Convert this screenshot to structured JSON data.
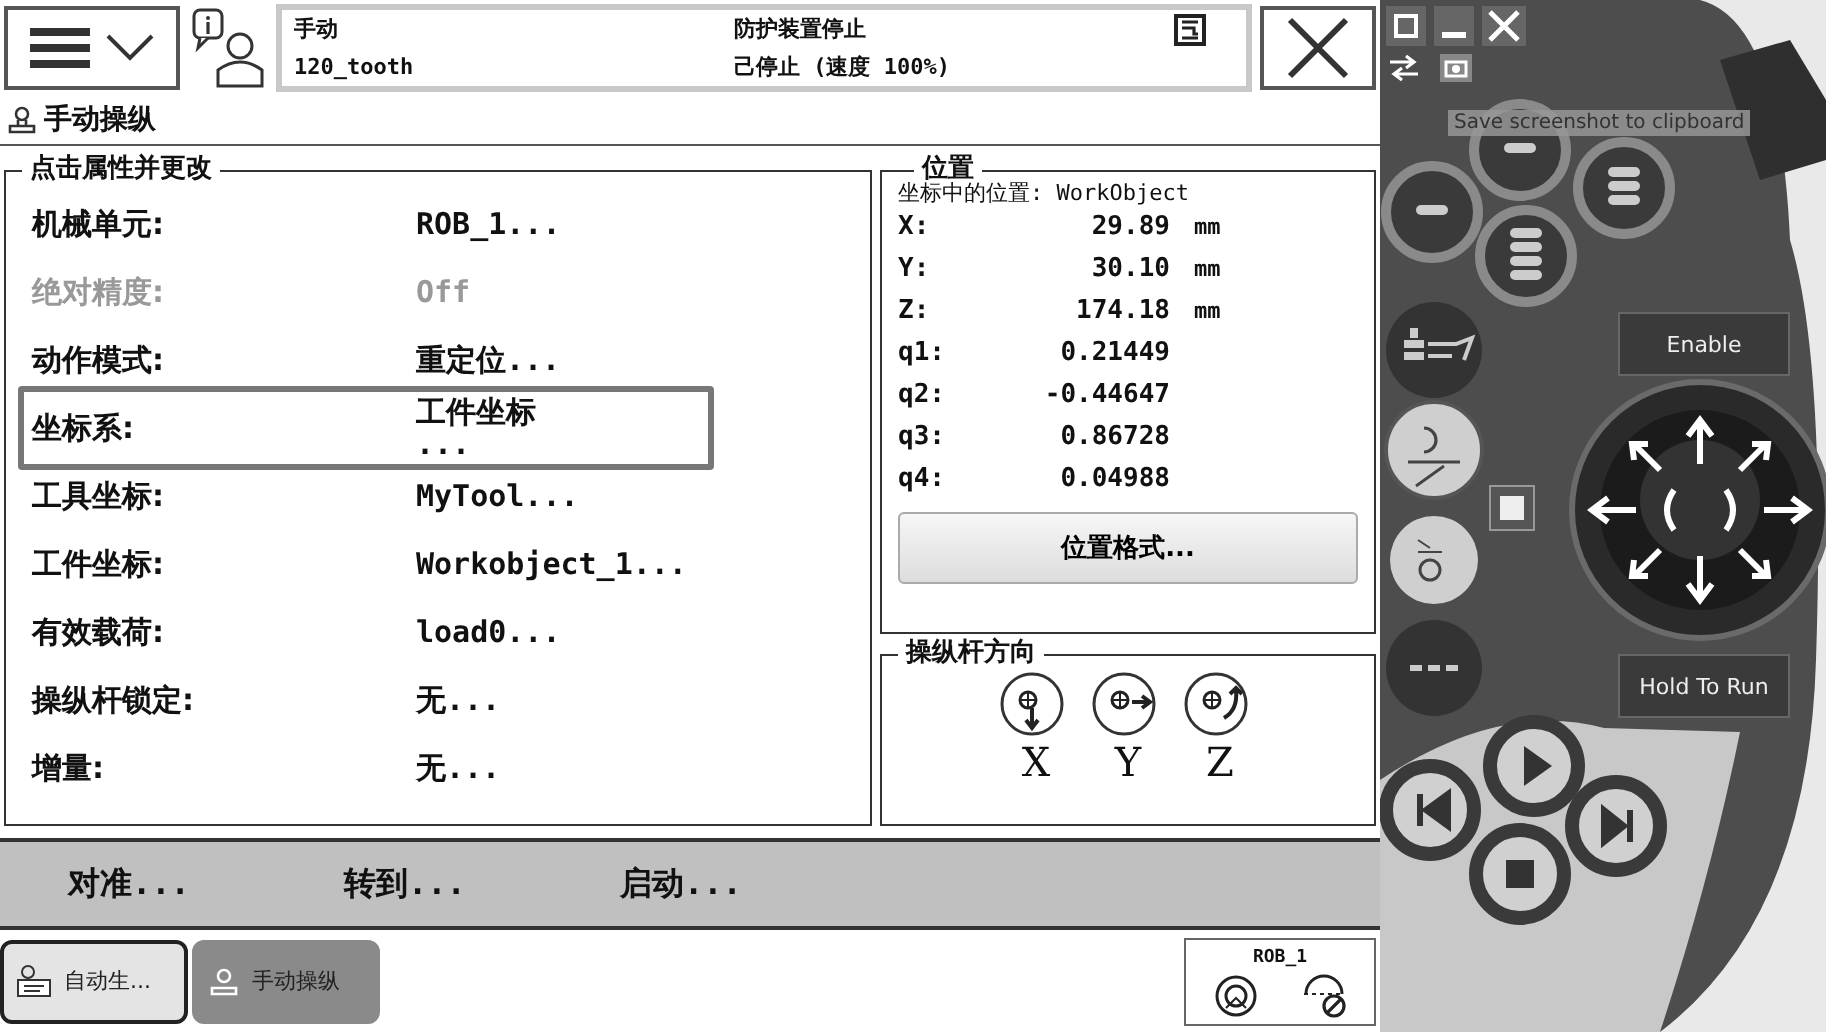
{
  "status_bar": {
    "mode": "手动",
    "program": "120_tooth",
    "safety": "防护装置停止",
    "state": "己停止 (速度 100%)"
  },
  "page_title": "手动操纵",
  "properties": {
    "title": "点击属性并更改",
    "rows": [
      {
        "label": "机械单元:",
        "value": "ROB_1...",
        "disabled": false,
        "selected": false
      },
      {
        "label": "绝对精度:",
        "value": "Off",
        "disabled": true,
        "selected": false
      },
      {
        "label": "动作模式:",
        "value": "重定位...",
        "disabled": false,
        "selected": false
      },
      {
        "label": "坐标系:",
        "value": "工件坐标\n...",
        "disabled": false,
        "selected": true
      },
      {
        "label": "工具坐标:",
        "value": "MyTool...",
        "disabled": false,
        "selected": false
      },
      {
        "label": "工件坐标:",
        "value": "Workobject_1...",
        "disabled": false,
        "selected": false
      },
      {
        "label": "有效载荷:",
        "value": "load0...",
        "disabled": false,
        "selected": false
      },
      {
        "label": "操纵杆锁定:",
        "value": "无...",
        "disabled": false,
        "selected": false
      },
      {
        "label": "增量:",
        "value": "无...",
        "disabled": false,
        "selected": false
      }
    ]
  },
  "position": {
    "title": "位置",
    "subtitle": "坐标中的位置: WorkObject",
    "rows": [
      {
        "label": "X:",
        "value": "29.89",
        "unit": "mm"
      },
      {
        "label": "Y:",
        "value": "30.10",
        "unit": "mm"
      },
      {
        "label": "Z:",
        "value": "174.18",
        "unit": "mm"
      },
      {
        "label": "q1:",
        "value": "0.21449"
      },
      {
        "label": "q2:",
        "value": "-0.44647"
      },
      {
        "label": "q3:",
        "value": "0.86728"
      },
      {
        "label": "q4:",
        "value": "0.04988"
      }
    ],
    "button": "位置格式..."
  },
  "joystick": {
    "title": "操纵杆方向",
    "axes": [
      "X",
      "Y",
      "Z"
    ]
  },
  "actions": [
    "对准...",
    "转到...",
    "启动..."
  ],
  "taskbar": {
    "tasks": [
      {
        "label": "自动生...",
        "selected": false
      },
      {
        "label": "手动操纵",
        "selected": true
      }
    ],
    "robot": "ROB_1"
  },
  "pendant": {
    "tooltip": "Save screenshot to clipboard",
    "enable": "Enable",
    "hold_to_run": "Hold To Run"
  }
}
